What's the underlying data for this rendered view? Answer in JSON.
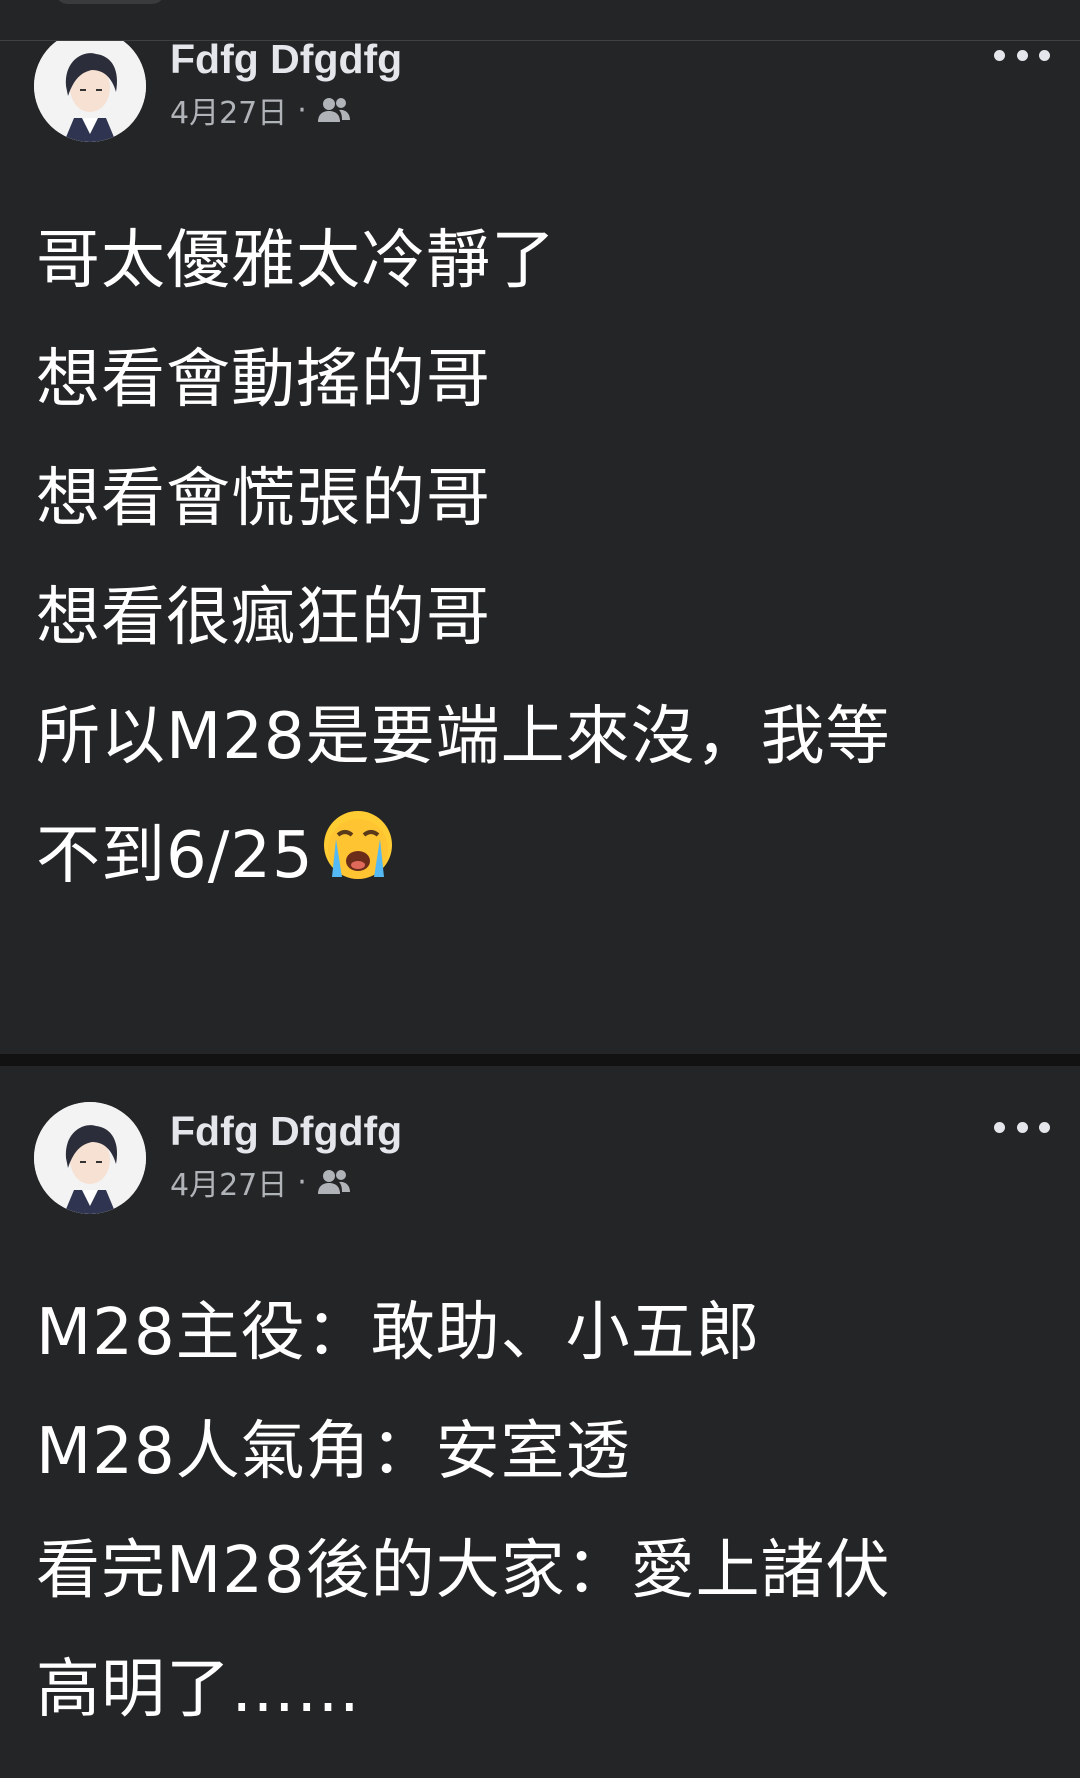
{
  "posts": [
    {
      "author": "Fdfg Dfgdfg",
      "date": "4月27日",
      "separator_dot": "·",
      "audience_icon": "friends-icon",
      "lines": [
        "哥太優雅太冷靜了",
        "想看會動搖的哥",
        "想看會慌張的哥",
        "想看很瘋狂的哥",
        "所以M28是要端上來沒，我等",
        "不到6/25"
      ],
      "emoji": "crying-face-emoji"
    },
    {
      "author": "Fdfg Dfgdfg",
      "date": "4月27日",
      "separator_dot": "·",
      "audience_icon": "friends-icon",
      "lines": [
        "M28主役：敢助、小五郎",
        "M28人氣角：安室透",
        "看完M28後的大家：愛上諸伏",
        "高明了……"
      ]
    }
  ],
  "colors": {
    "background": "#242526",
    "separator": "#121212",
    "text_primary": "#e4e6eb",
    "text_secondary": "#b0b3b8"
  }
}
